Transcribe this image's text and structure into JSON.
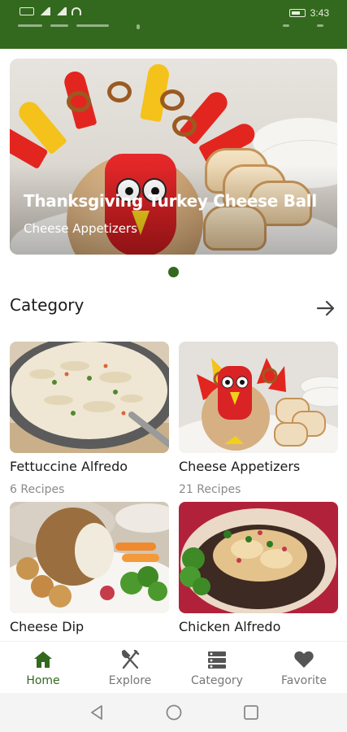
{
  "status_bar": {
    "time": "3:43",
    "left_icons": [
      "hd-icon",
      "signal-icon",
      "signal-icon",
      "wifi-icon"
    ],
    "right_icons": [
      "battery-icon"
    ],
    "background": "#33691e"
  },
  "hero": {
    "title": "Thanksgiving Turkey Cheese Ball",
    "subtitle": "Cheese Appetizers",
    "page_index": 1,
    "page_count": 1
  },
  "category_section": {
    "title": "Category",
    "more_icon": "arrow-right-icon"
  },
  "categories": [
    {
      "title": "Fettuccine Alfredo",
      "count": "6 Recipes"
    },
    {
      "title": "Cheese Appetizers",
      "count": "21 Recipes"
    },
    {
      "title": "Cheese Dip",
      "count": ""
    },
    {
      "title": "Chicken Alfredo",
      "count": ""
    }
  ],
  "bottom_nav": {
    "active": "home",
    "items": [
      {
        "label": "Home",
        "icon": "home-icon"
      },
      {
        "label": "Explore",
        "icon": "fork-knife-icon"
      },
      {
        "label": "Category",
        "icon": "category-icon"
      },
      {
        "label": "Favorite",
        "icon": "heart-icon"
      }
    ]
  },
  "system_nav": [
    "back-icon",
    "home-circle-icon",
    "recents-icon"
  ],
  "colors": {
    "accent": "#33691e",
    "text": "#1a1a1a",
    "muted": "#8a8a8a"
  }
}
